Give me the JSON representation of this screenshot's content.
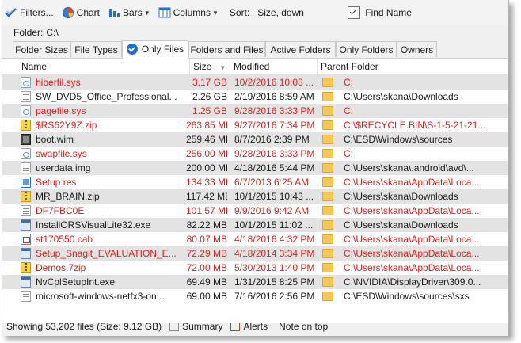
{
  "toolbar": {
    "filters_label": "Filters...",
    "chart_label": "Chart",
    "bars_label": "Bars",
    "columns_label": "Columns",
    "sort_label": "Sort:",
    "sort_value": "Size, down",
    "find_label": "Find Name"
  },
  "folder": {
    "label": "Folder:",
    "path": "C:\\"
  },
  "tabs": [
    {
      "label": "Folder Sizes"
    },
    {
      "label": "File Types"
    },
    {
      "label": "Only Files"
    },
    {
      "label": "Folders and Files"
    },
    {
      "label": "Active Folders"
    },
    {
      "label": "Only Folders"
    },
    {
      "label": "Owners"
    }
  ],
  "columns": {
    "name": "Name",
    "size": "Size",
    "modified": "Modified",
    "parent": "Parent Folder"
  },
  "rows": [
    {
      "icon": "sys-file-icon",
      "name": "hiberfil.sys",
      "size": "3.17 GB",
      "modified": "10/2/2016 10:08 ...",
      "parent": "C:"
    },
    {
      "icon": "document-icon",
      "name": "SW_DVD5_Office_Professional...",
      "size": "2.26 GB",
      "modified": "2/19/2016 8:59 AM",
      "parent": "C:\\Users\\skana\\Downloads"
    },
    {
      "icon": "sys-file-icon",
      "name": "pagefile.sys",
      "size": "1.25 GB",
      "modified": "9/28/2016 3:33 PM",
      "parent": "C:"
    },
    {
      "icon": "zip-icon",
      "name": "$RS62Y9Z.zip",
      "size": "263.85 MB",
      "modified": "9/27/2016 7:34 PM",
      "parent": "C:\\$RECYCLE.BIN\\S-1-5-21-21..."
    },
    {
      "icon": "wim-icon",
      "name": "boot.wim",
      "size": "259.46 MB",
      "modified": "8/7/2016 2:39 PM",
      "parent": "C:\\ESD\\Windows\\sources"
    },
    {
      "icon": "sys-file-icon",
      "name": "swapfile.sys",
      "size": "256.00 MB",
      "modified": "9/28/2016 3:33 PM",
      "parent": "C:"
    },
    {
      "icon": "document-icon",
      "name": "userdata.img",
      "size": "200.00 MB",
      "modified": "4/18/2016 5:44 PM",
      "parent": "C:\\Users\\skana\\.android\\avd\\..."
    },
    {
      "icon": "resource-icon",
      "name": "Setup.res",
      "size": "134.33 MB",
      "modified": "6/7/2013 6:25 AM",
      "parent": "C:\\Users\\skana\\AppData\\Loca..."
    },
    {
      "icon": "zip-icon",
      "name": "MR_BRAIN.zip",
      "size": "117.42 MB",
      "modified": "10/1/2015 10:43 ...",
      "parent": "C:\\Users\\skana\\Downloads"
    },
    {
      "icon": "document-icon",
      "name": "DF7FBC0E",
      "size": "101.57 MB",
      "modified": "9/9/2016 9:42 AM",
      "parent": "C:\\Users\\skana\\AppData\\Loca..."
    },
    {
      "icon": "exe-icon",
      "name": "InstallORSVisualLite32.exe",
      "size": "82.22 MB",
      "modified": "10/1/2015 11:02 ...",
      "parent": "C:\\Users\\skana\\Downloads"
    },
    {
      "icon": "cab-icon",
      "name": "st170550.cab",
      "size": "80.07 MB",
      "modified": "4/18/2016 4:32 PM",
      "parent": "C:\\Users\\skana\\AppData\\Loca..."
    },
    {
      "icon": "exe-icon",
      "name": "Setup_Snagit_EVALUATION_E...",
      "size": "72.29 MB",
      "modified": "4/18/2014 3:34 PM",
      "parent": "C:\\Users\\skana\\AppData\\Loca..."
    },
    {
      "icon": "zip-icon",
      "name": "Demos.7zip",
      "size": "72.00 MB",
      "modified": "5/30/2013 1:40 PM",
      "parent": "C:\\Users\\skana\\AppData\\Loca..."
    },
    {
      "icon": "exe-icon",
      "name": "NvCplSetupInt.exe",
      "size": "69.49 MB",
      "modified": "1/31/2015 8:25 PM",
      "parent": "C:\\NVIDIA\\DisplayDriver\\309.0..."
    },
    {
      "icon": "document-icon",
      "name": "microsoft-windows-netfx3-on...",
      "size": "69.00 MB",
      "modified": "7/16/2016 2:56 PM",
      "parent": "C:\\ESD\\Windows\\sources\\sxs"
    }
  ],
  "row_styles": {
    "red_rows": [
      0,
      2,
      3,
      5,
      7,
      9,
      11,
      12,
      13
    ],
    "alt_rows": [
      0,
      2,
      4,
      6,
      8,
      10,
      12,
      14
    ],
    "red_color": "#e0201a",
    "alt_color": "#e3e3e3"
  },
  "status": {
    "files_text": "Showing 53,202 files (Size: 9.12 GB)",
    "summary_label": "Summary",
    "alerts_label": "Alerts",
    "note_label": "Note on top"
  }
}
